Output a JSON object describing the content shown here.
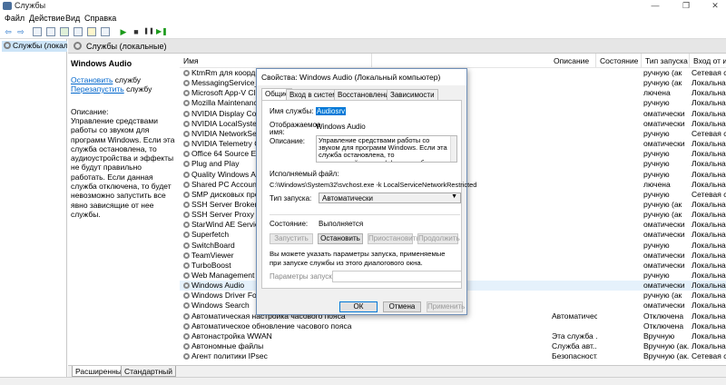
{
  "window": {
    "title": "Службы",
    "min_glyph": "—",
    "max_glyph": "❐",
    "close_glyph": "✕"
  },
  "menu": [
    "Файл",
    "Действие",
    "Вид",
    "Справка"
  ],
  "toolbar": {
    "back_glyph": "⇦",
    "forward_glyph": "⇨",
    "play_glyph": "▶",
    "stop_glyph": "■",
    "pause_glyph": "❚❚",
    "restart_glyph": "▶❚"
  },
  "tree": {
    "root_label": "Службы (локальны"
  },
  "header": {
    "title": "Службы (локальные)"
  },
  "details": {
    "service_name": "Windows Audio",
    "stop_link": "Остановить",
    "stop_suffix": " службу",
    "restart_link": "Перезапустить",
    "restart_suffix": " службу",
    "description_label": "Описание:",
    "description": "Управление средствами работы со звуком для программ Windows. Если эта служба остановлена, то аудиоустройства и эффекты не будут правильно работать. Если данная служба отключена, то будет невозможно запустить все явно зависящие от нее службы."
  },
  "columns": [
    "Имя",
    "Описание",
    "Состояние",
    "Тип запуска",
    "Вход от имени"
  ],
  "services": [
    {
      "name": "KtmRm для координа",
      "desc": "",
      "state": "",
      "start": "ручную (ак",
      "logon": "Сетевая служба"
    },
    {
      "name": "MessagingService_2ee",
      "desc": "",
      "state": "",
      "start": "ручную (ак",
      "logon": "Локальная систе"
    },
    {
      "name": "Microsoft App-V Client",
      "desc": "",
      "state": "",
      "start": "лючена",
      "logon": "Локальная систе"
    },
    {
      "name": "Mozilla Maintenance S",
      "desc": "",
      "state": "",
      "start": "ручную",
      "logon": "Локальная систе"
    },
    {
      "name": "NVIDIA Display Contai",
      "desc": "",
      "state": "",
      "start": "оматически",
      "logon": "Локальная систе"
    },
    {
      "name": "NVIDIA LocalSystem C",
      "desc": "",
      "state": "",
      "start": "оматически",
      "logon": "Локальная систе"
    },
    {
      "name": "NVIDIA NetworkServic",
      "desc": "",
      "state": "",
      "start": "ручную",
      "logon": "Сетевая служба"
    },
    {
      "name": "NVIDIA Telemetry Con",
      "desc": "",
      "state": "",
      "start": "оматически",
      "logon": "Локальная систе"
    },
    {
      "name": "Office 64 Source Engin",
      "desc": "",
      "state": "",
      "start": "ручную",
      "logon": "Локальная систе"
    },
    {
      "name": "Plug and Play",
      "desc": "",
      "state": "",
      "start": "ручную",
      "logon": "Локальная систе"
    },
    {
      "name": "Quality Windows Audi",
      "desc": "",
      "state": "",
      "start": "ручную",
      "logon": "Локальная служба"
    },
    {
      "name": "Shared PC Account Ma",
      "desc": "",
      "state": "",
      "start": "лючена",
      "logon": "Локальная систе"
    },
    {
      "name": "SMP дисковых простр",
      "desc": "",
      "state": "",
      "start": "ручную",
      "logon": "Сетевая служба"
    },
    {
      "name": "SSH Server Broker",
      "desc": "",
      "state": "",
      "start": "ручную (ак",
      "logon": "Локальная систе"
    },
    {
      "name": "SSH Server Proxy",
      "desc": "",
      "state": "",
      "start": "ручную (ак",
      "logon": "Локальная систе"
    },
    {
      "name": "StarWind AE Service",
      "desc": "",
      "state": "",
      "start": "оматически",
      "logon": "Локальная систе"
    },
    {
      "name": "Superfetch",
      "desc": "",
      "state": "",
      "start": "оматически",
      "logon": "Локальная систе"
    },
    {
      "name": "SwitchBoard",
      "desc": "",
      "state": "",
      "start": "ручную",
      "logon": "Локальная систе"
    },
    {
      "name": "TeamViewer",
      "desc": "",
      "state": "",
      "start": "оматически",
      "logon": "Локальная систе"
    },
    {
      "name": "TurboBoost",
      "desc": "",
      "state": "",
      "start": "оматически",
      "logon": "Локальная систе"
    },
    {
      "name": "Web Management",
      "desc": "",
      "state": "",
      "start": "ручную",
      "logon": "Локальная систе"
    },
    {
      "name": "Windows Audio",
      "desc": "",
      "state": "",
      "start": "оматически",
      "logon": "Локальная служба",
      "selected": true
    },
    {
      "name": "Windows Driver Found",
      "desc": "",
      "state": "",
      "start": "ручную (ак",
      "logon": "Локальная систе"
    },
    {
      "name": "Windows Search",
      "desc": "",
      "state": "",
      "start": "оматически",
      "logon": "Локальная систе"
    },
    {
      "name": "Автоматическая настройка часового пояса",
      "desc": "Автоматичес...",
      "state": "",
      "start": "Отключена",
      "logon": "Локальная служба"
    },
    {
      "name": "Автоматическое обновление часового пояса",
      "desc": "",
      "state": "",
      "start": "Отключена",
      "logon": "Локальная служба"
    },
    {
      "name": "Автонастройка WWAN",
      "desc": "Эта служба ...",
      "state": "",
      "start": "Вручную",
      "logon": "Локальная систе"
    },
    {
      "name": "Автономные файлы",
      "desc": "Служба авт...",
      "state": "",
      "start": "Вручную (ак...",
      "logon": "Локальная систе"
    },
    {
      "name": "Агент политики IPsec",
      "desc": "Безопасност...",
      "state": "",
      "start": "Вручную (ак...",
      "logon": "Сетевая служба"
    }
  ],
  "bottom_tabs": [
    "Расширенный",
    "Стандартный"
  ],
  "dialog": {
    "title": "Свойства: Windows Audio (Локальный компьютер)",
    "tabs": [
      "Общие",
      "Вход в систему",
      "Восстановление",
      "Зависимости"
    ],
    "service_name_label": "Имя службы:",
    "service_name_value": "Audiosrv",
    "display_name_label_1": "Отображаемое",
    "display_name_label_2": "имя:",
    "display_name_value": "Windows Audio",
    "description_label": "Описание:",
    "description_value": "Управление средствами работы со звуком для программ Windows. Если эта служба остановлена, то аудиоустройства и эффекты не будут правильно работать. Если данная служба",
    "exe_label": "Исполняемый файл:",
    "exe_value": "C:\\Windows\\System32\\svchost.exe -k LocalServiceNetworkRestricted",
    "startup_label": "Тип запуска:",
    "startup_value": "Автоматически",
    "state_label": "Состояние:",
    "state_value": "Выполняется",
    "btn_start": "Запустить",
    "btn_stop": "Остановить",
    "btn_pause": "Приостановить",
    "btn_resume": "Продолжить",
    "hint": "Вы можете указать параметры запуска, применяемые при запуске службы из этого диалогового окна.",
    "params_label": "Параметры запуска:",
    "btn_ok": "ОК",
    "btn_cancel": "Отмена",
    "btn_apply": "Применить"
  }
}
